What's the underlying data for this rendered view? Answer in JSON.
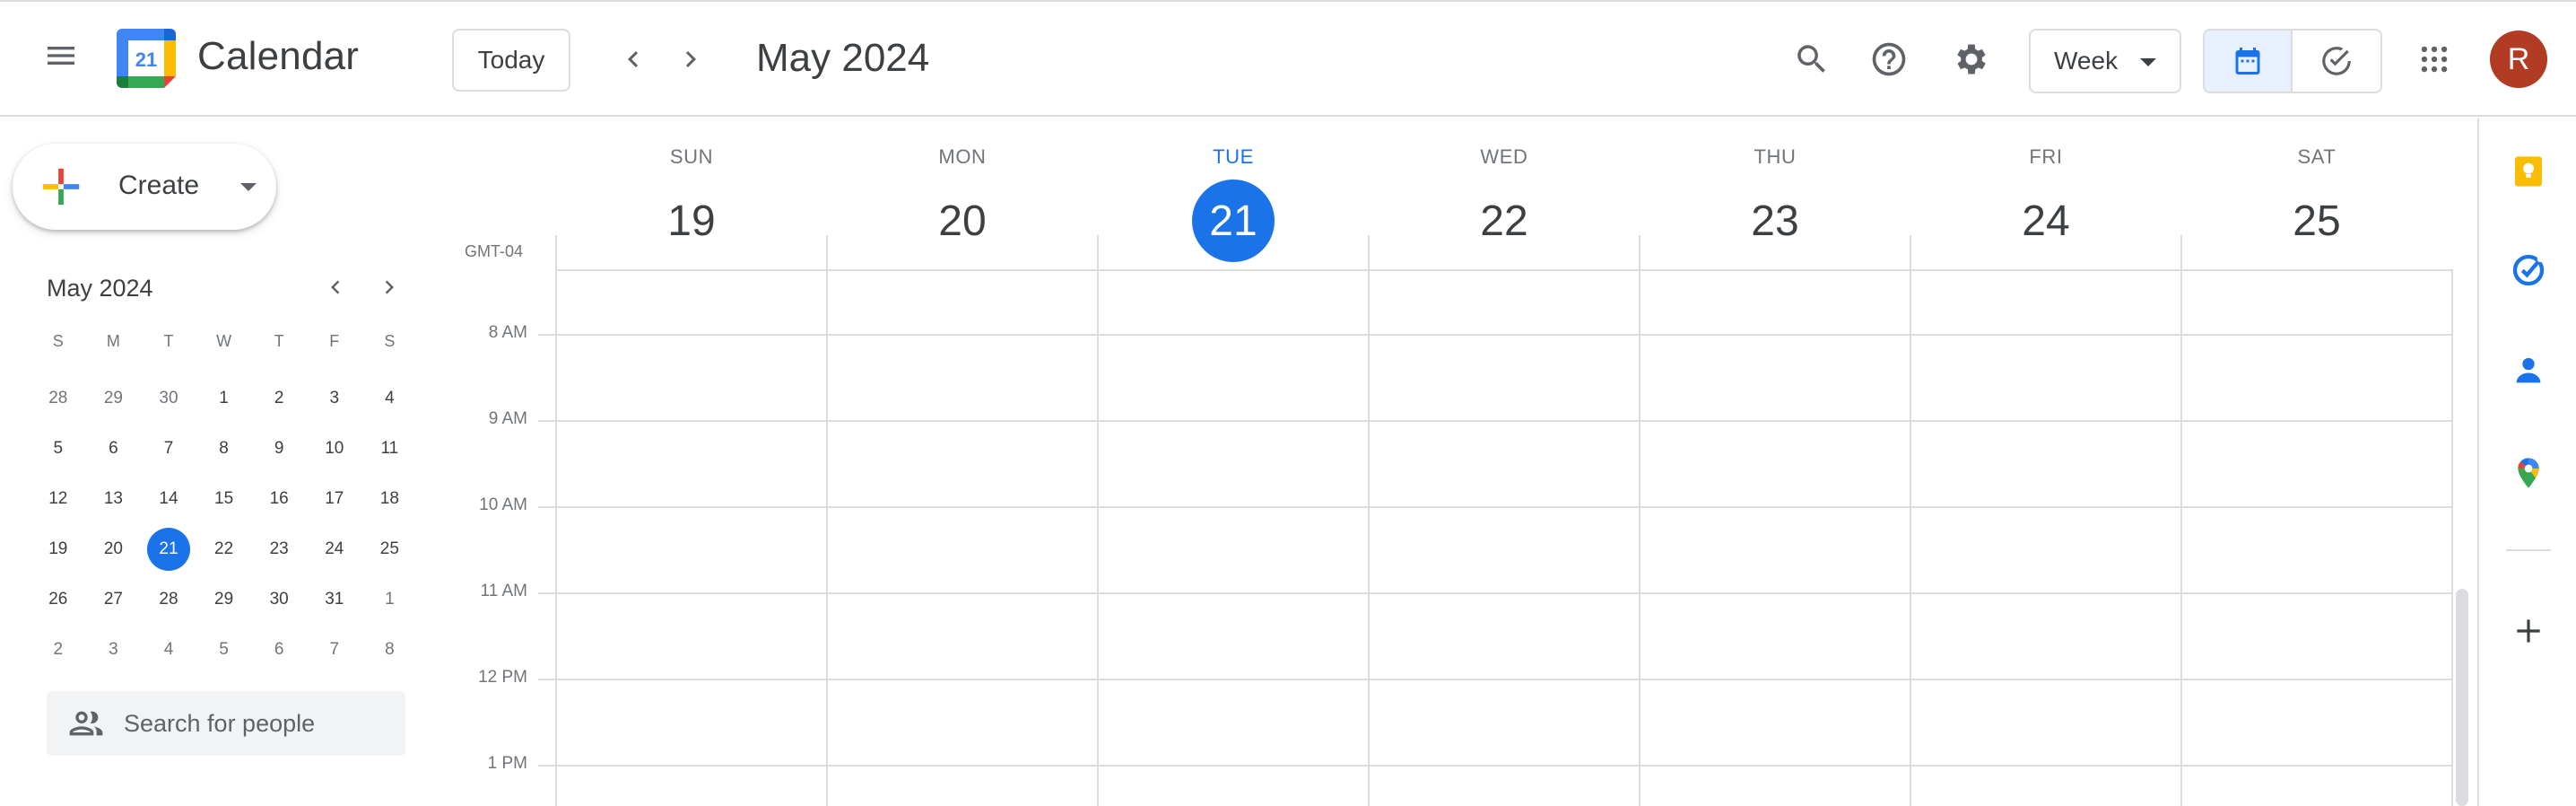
{
  "app": {
    "title": "Calendar",
    "logo_day": "21"
  },
  "header": {
    "today_label": "Today",
    "period_title": "May 2024",
    "view_label": "Week",
    "avatar_initial": "R"
  },
  "sidebar": {
    "create_label": "Create",
    "mini_calendar": {
      "title": "May 2024",
      "weekday_headers": [
        "S",
        "M",
        "T",
        "W",
        "T",
        "F",
        "S"
      ],
      "weeks": [
        [
          {
            "d": "28",
            "o": true
          },
          {
            "d": "29",
            "o": true
          },
          {
            "d": "30",
            "o": true
          },
          {
            "d": "1"
          },
          {
            "d": "2"
          },
          {
            "d": "3"
          },
          {
            "d": "4"
          }
        ],
        [
          {
            "d": "5"
          },
          {
            "d": "6"
          },
          {
            "d": "7"
          },
          {
            "d": "8"
          },
          {
            "d": "9"
          },
          {
            "d": "10"
          },
          {
            "d": "11"
          }
        ],
        [
          {
            "d": "12"
          },
          {
            "d": "13"
          },
          {
            "d": "14"
          },
          {
            "d": "15"
          },
          {
            "d": "16"
          },
          {
            "d": "17"
          },
          {
            "d": "18"
          }
        ],
        [
          {
            "d": "19"
          },
          {
            "d": "20"
          },
          {
            "d": "21",
            "sel": true
          },
          {
            "d": "22"
          },
          {
            "d": "23"
          },
          {
            "d": "24"
          },
          {
            "d": "25"
          }
        ],
        [
          {
            "d": "26"
          },
          {
            "d": "27"
          },
          {
            "d": "28"
          },
          {
            "d": "29"
          },
          {
            "d": "30"
          },
          {
            "d": "31"
          },
          {
            "d": "1",
            "o": true
          }
        ],
        [
          {
            "d": "2",
            "o": true
          },
          {
            "d": "3",
            "o": true
          },
          {
            "d": "4",
            "o": true
          },
          {
            "d": "5",
            "o": true
          },
          {
            "d": "6",
            "o": true
          },
          {
            "d": "7",
            "o": true
          },
          {
            "d": "8",
            "o": true
          }
        ]
      ]
    },
    "people_search_placeholder": "Search for people"
  },
  "week_view": {
    "timezone": "GMT-04",
    "days": [
      {
        "dow": "SUN",
        "date": "19"
      },
      {
        "dow": "MON",
        "date": "20"
      },
      {
        "dow": "TUE",
        "date": "21",
        "today": true
      },
      {
        "dow": "WED",
        "date": "22"
      },
      {
        "dow": "THU",
        "date": "23"
      },
      {
        "dow": "FRI",
        "date": "24"
      },
      {
        "dow": "SAT",
        "date": "25"
      }
    ],
    "hours": [
      "8 AM",
      "9 AM",
      "10 AM",
      "11 AM",
      "12 PM",
      "1 PM"
    ]
  },
  "side_panel": {
    "items": [
      "keep-icon",
      "tasks-icon",
      "contacts-icon",
      "maps-icon",
      "add-addon-icon"
    ]
  },
  "colors": {
    "accent": "#1a73e8",
    "avatar": "#b23b24",
    "border": "#dadce0",
    "text": "#3c4043",
    "muted": "#70757a"
  }
}
